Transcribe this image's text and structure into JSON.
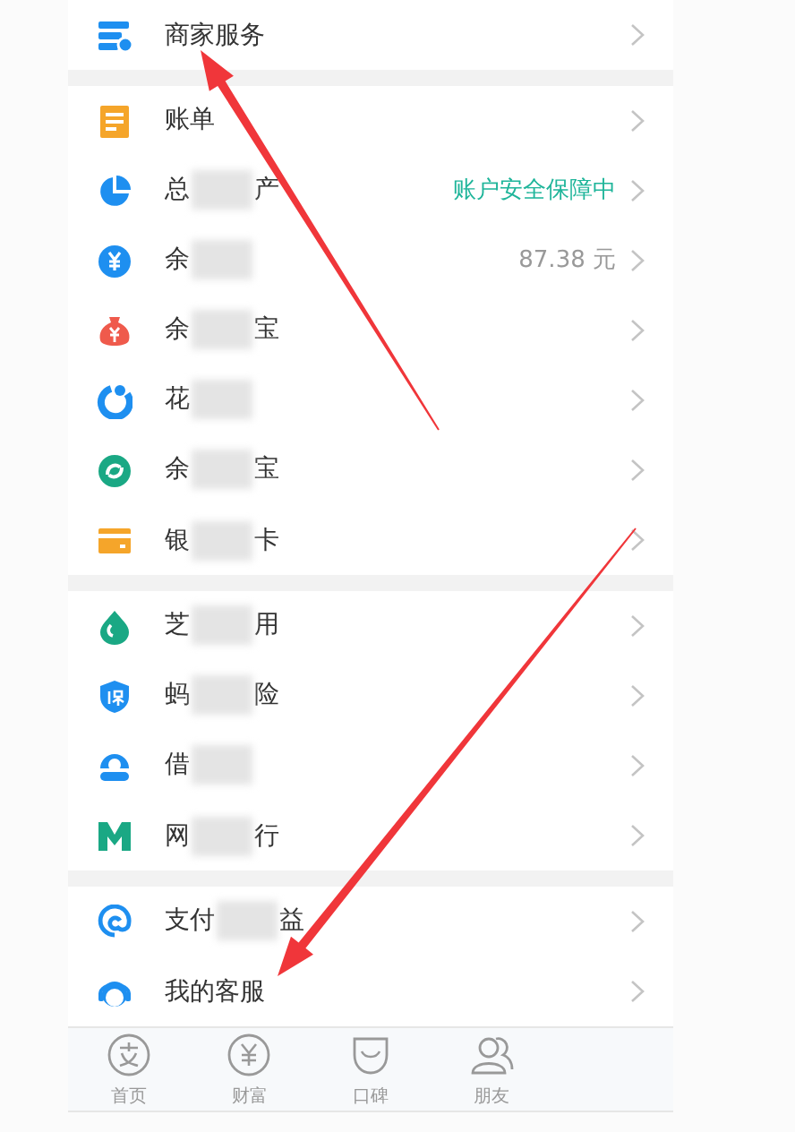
{
  "groups": [
    {
      "rows": [
        {
          "label": "商家服务",
          "blurred": false
        }
      ]
    },
    {
      "rows": [
        {
          "label": "账单",
          "blurred": false
        },
        {
          "label": "总",
          "label_end": "产",
          "blurred": true,
          "value": "账户安全保障中",
          "kind": "status"
        },
        {
          "label": "余",
          "blurred": true,
          "value": "87.38 元",
          "kind": "amount"
        },
        {
          "label": "余",
          "label_end": "宝",
          "blurred": true
        },
        {
          "label": "花",
          "blurred": true
        },
        {
          "label": "余",
          "label_end": "宝",
          "blurred": true
        },
        {
          "label": "银",
          "label_end": "卡",
          "blurred": true
        }
      ]
    },
    {
      "rows": [
        {
          "label": "芝",
          "label_end": "用",
          "blurred": true
        },
        {
          "label": "蚂",
          "label_end": "险",
          "blurred": true
        },
        {
          "label": "借",
          "blurred": true
        },
        {
          "label": "网",
          "label_end": "行",
          "blurred": true
        }
      ]
    },
    {
      "rows": [
        {
          "label": "支付",
          "label_end": "益",
          "blurred": true
        },
        {
          "label": "我的客服",
          "blurred": false
        }
      ]
    }
  ],
  "tab_bar": [
    {
      "label": "首页"
    },
    {
      "label": "财富"
    },
    {
      "label": "口碑"
    },
    {
      "label": "朋友"
    }
  ],
  "annotations": [
    {
      "kind": "arrow"
    },
    {
      "kind": "arrow"
    }
  ]
}
